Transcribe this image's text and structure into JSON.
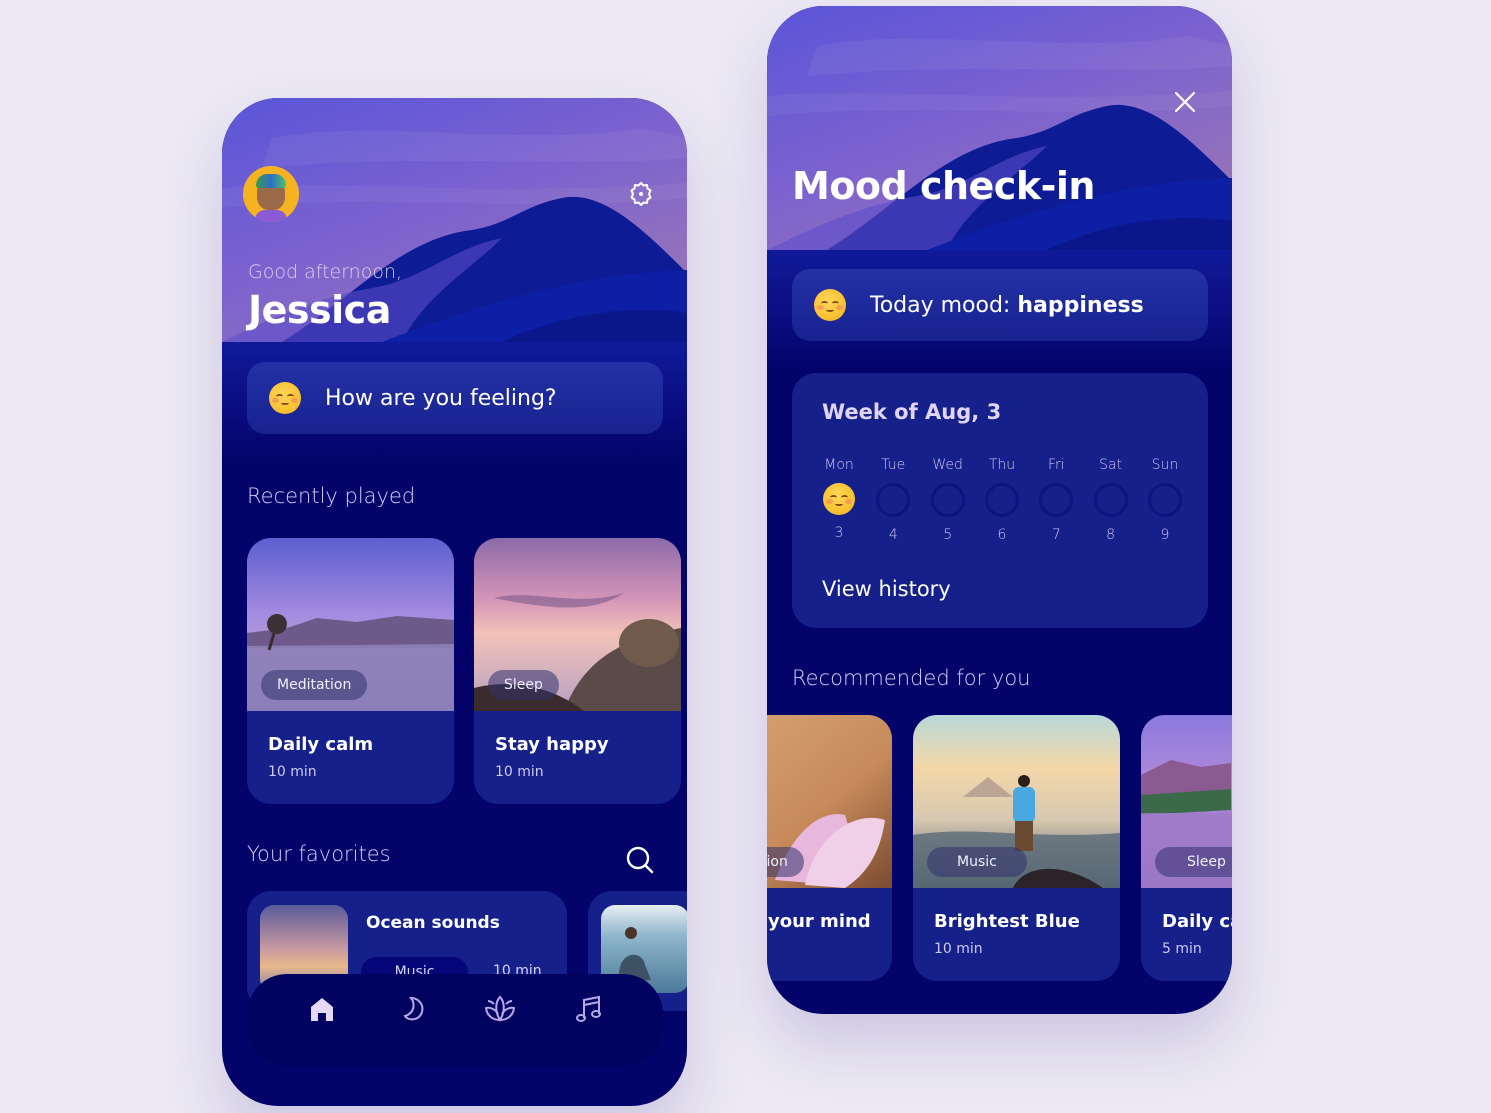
{
  "home": {
    "greeting": "Good afternoon,",
    "user_name": "Jessica",
    "mood_prompt": "How are you feeling?",
    "recently_played_title": "Recently played",
    "recently_played": [
      {
        "tag": "Meditation",
        "title": "Daily calm",
        "duration": "10 min"
      },
      {
        "tag": "Sleep",
        "title": "Stay happy",
        "duration": "10 min"
      }
    ],
    "favorites_title": "Your favorites",
    "favorites": [
      {
        "title": "Ocean sounds",
        "tag": "Music",
        "duration": "10 min"
      }
    ],
    "nav": [
      {
        "label": "home",
        "icon": "home-icon",
        "active": true
      },
      {
        "label": "sleep",
        "icon": "moon-icon",
        "active": false
      },
      {
        "label": "meditation",
        "icon": "lotus-icon",
        "active": false
      },
      {
        "label": "music",
        "icon": "music-note-icon",
        "active": false
      }
    ]
  },
  "mood": {
    "title": "Mood check-in",
    "today_label": "Today mood:",
    "today_value": "happiness",
    "week_title": "Week of Aug, 3",
    "days": [
      {
        "name": "Mon",
        "date": "3",
        "logged": true
      },
      {
        "name": "Tue",
        "date": "4",
        "logged": false
      },
      {
        "name": "Wed",
        "date": "5",
        "logged": false
      },
      {
        "name": "Thu",
        "date": "6",
        "logged": false
      },
      {
        "name": "Fri",
        "date": "7",
        "logged": false
      },
      {
        "name": "Sat",
        "date": "8",
        "logged": false
      },
      {
        "name": "Sun",
        "date": "9",
        "logged": false
      }
    ],
    "view_history": "View history",
    "recommended_title": "Recommended for you",
    "recommended": [
      {
        "tag": "tion",
        "title": "your mind",
        "duration": ""
      },
      {
        "tag": "Music",
        "title": "Brightest Blue",
        "duration": "10 min"
      },
      {
        "tag": "Sleep",
        "title": "Daily ca",
        "duration": "5 min"
      }
    ]
  },
  "colors": {
    "background": "#ece9f4",
    "phone_bg": "#03036a",
    "card_bg": "#15208a",
    "accent_text": "#e0d4fb"
  }
}
